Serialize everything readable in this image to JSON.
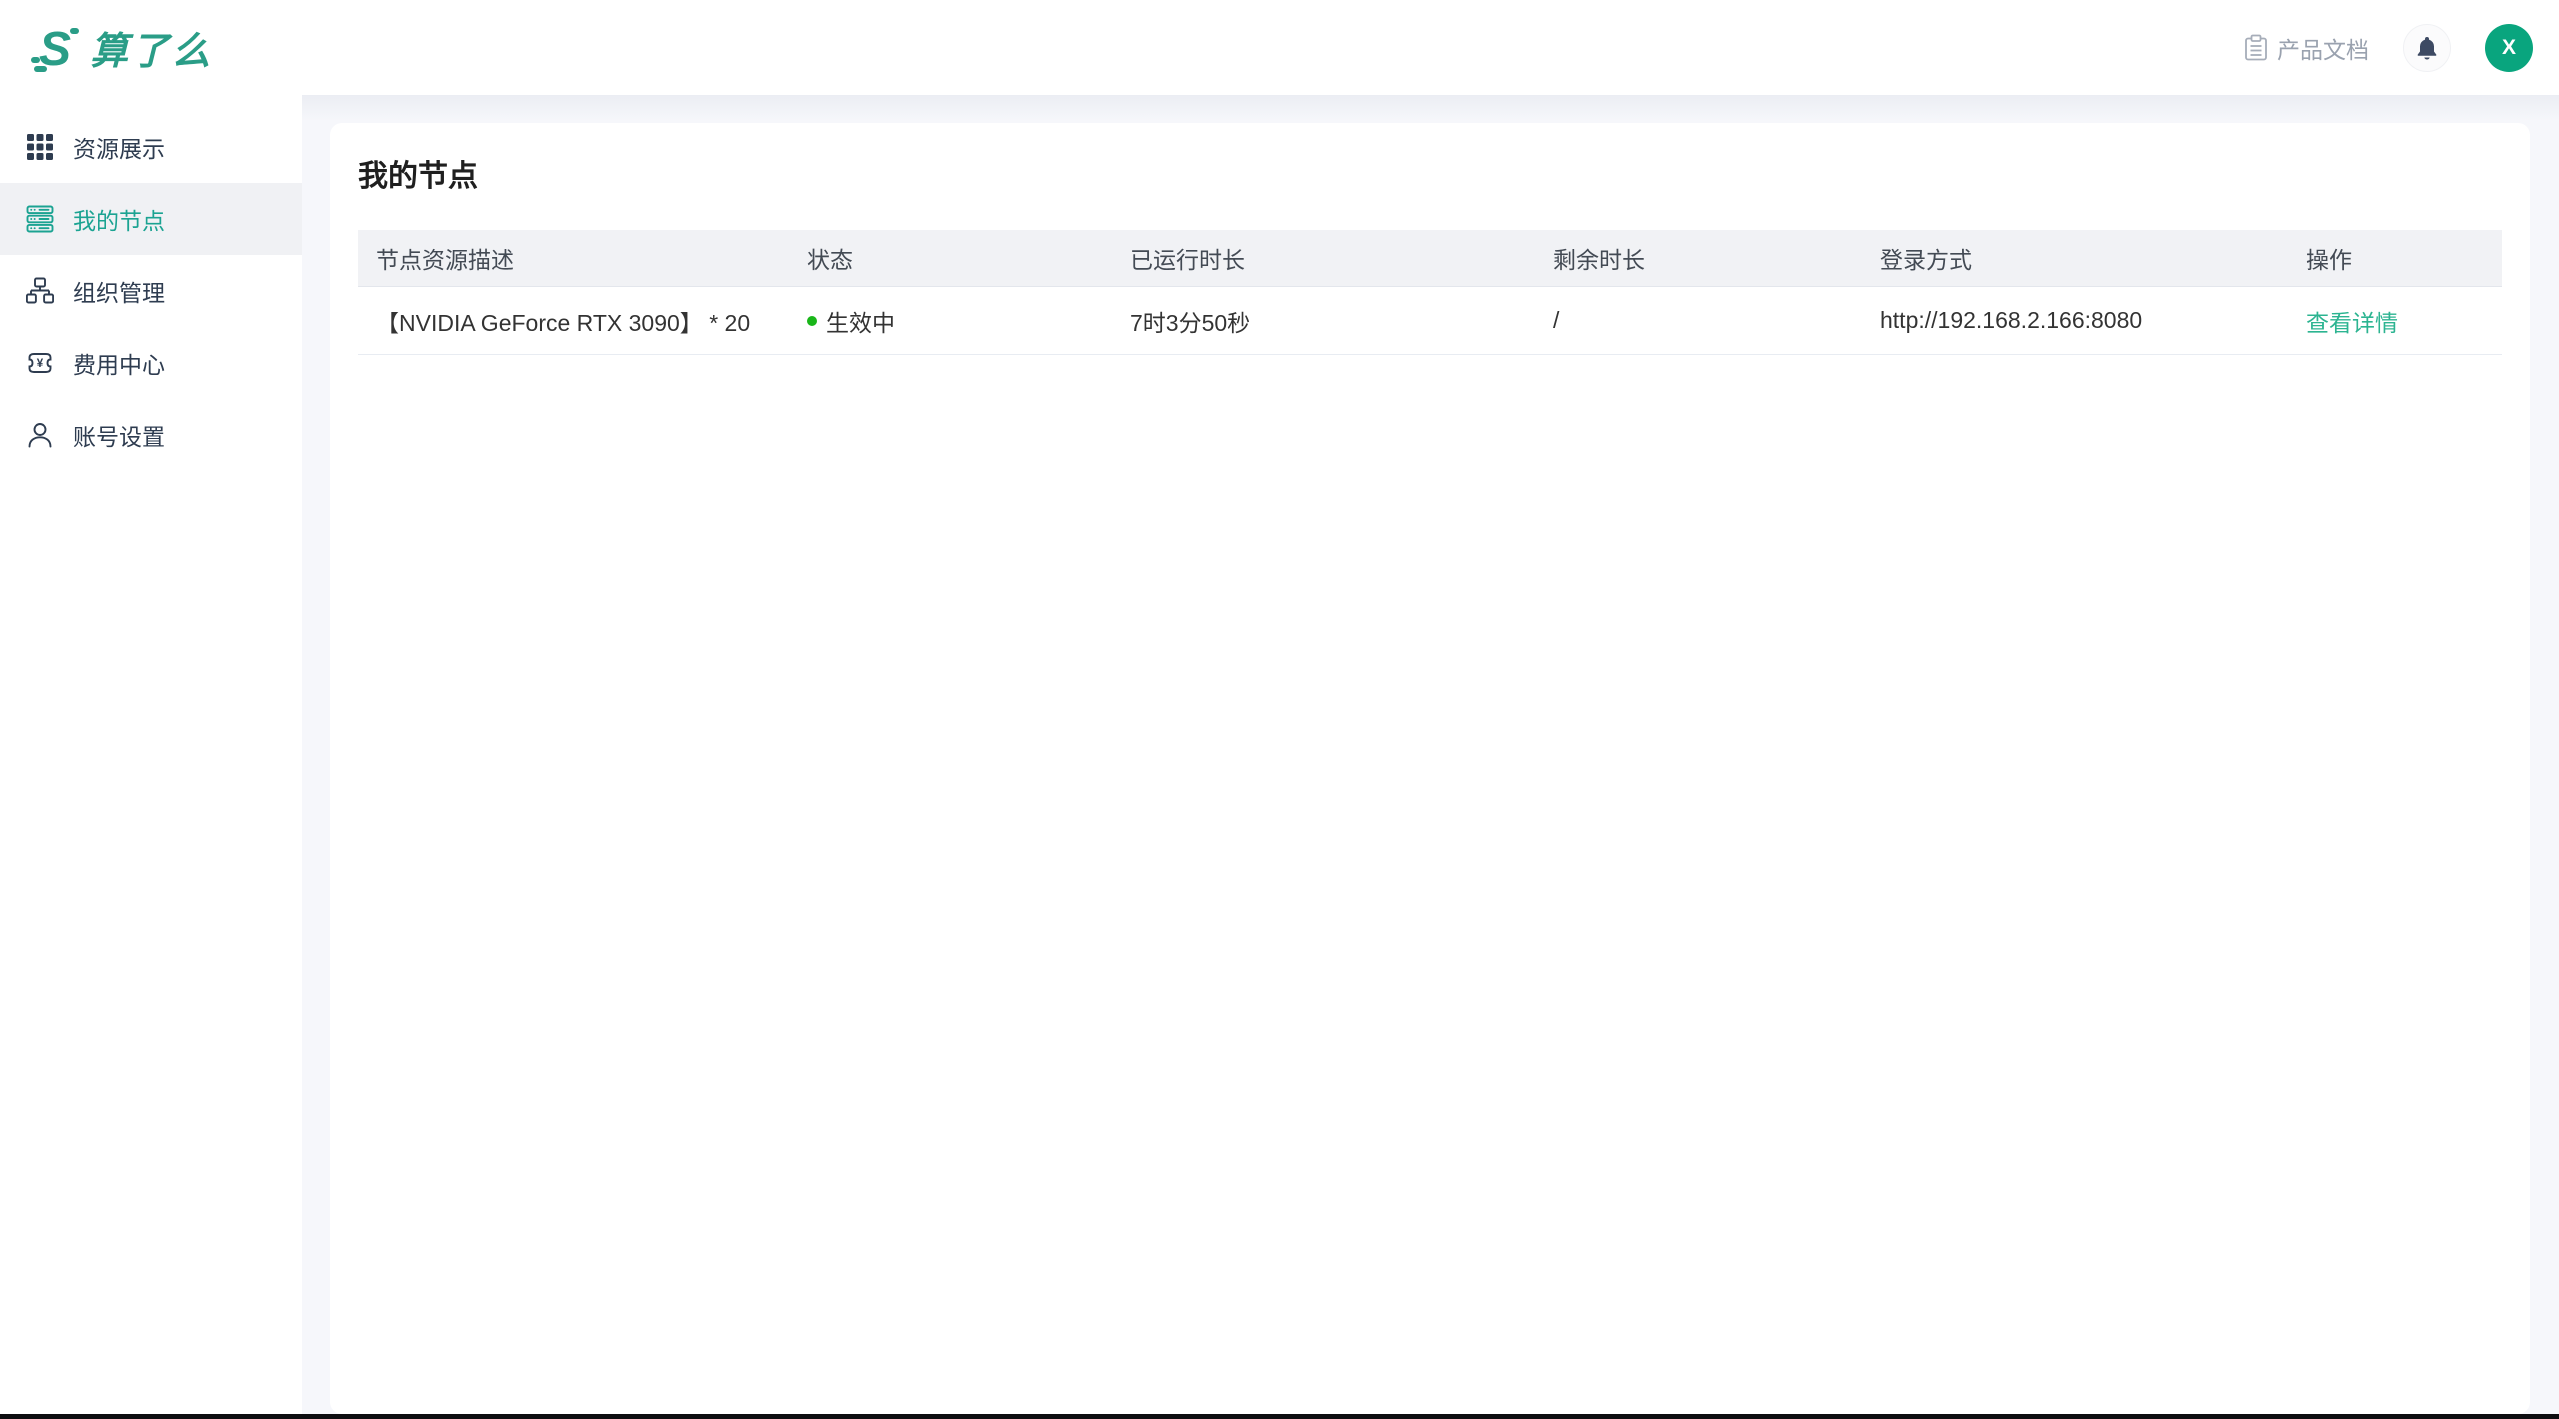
{
  "app": {
    "logo_mark": "S",
    "logo_text": "算了么"
  },
  "header": {
    "docs_label": "产品文档",
    "avatar_initial": "X"
  },
  "sidebar": {
    "items": [
      {
        "label": "资源展示",
        "icon": "grid-icon",
        "active": false
      },
      {
        "label": "我的节点",
        "icon": "server-icon",
        "active": true
      },
      {
        "label": "组织管理",
        "icon": "org-chart-icon",
        "active": false
      },
      {
        "label": "费用中心",
        "icon": "billing-ticket-icon",
        "active": false
      },
      {
        "label": "账号设置",
        "icon": "user-icon",
        "active": false
      }
    ]
  },
  "main": {
    "title": "我的节点",
    "table": {
      "columns": [
        "节点资源描述",
        "状态",
        "已运行时长",
        "剩余时长",
        "登录方式",
        "操作"
      ],
      "rows": [
        {
          "description": "【NVIDIA GeForce RTX 3090】 * 20",
          "status": "生效中",
          "uptime": "7时3分50秒",
          "remaining": "/",
          "login": "http://192.168.2.166:8080",
          "action": "查看详情"
        }
      ]
    }
  },
  "colors": {
    "brand_teal": "#2a9d87",
    "sidebar_active_teal": "#1ba392",
    "link_teal": "#2cb491",
    "avatar_green": "#09a57e",
    "status_green": "#19b619",
    "table_header_bg": "#f1f2f5",
    "page_bg": "#f6f7fb"
  }
}
